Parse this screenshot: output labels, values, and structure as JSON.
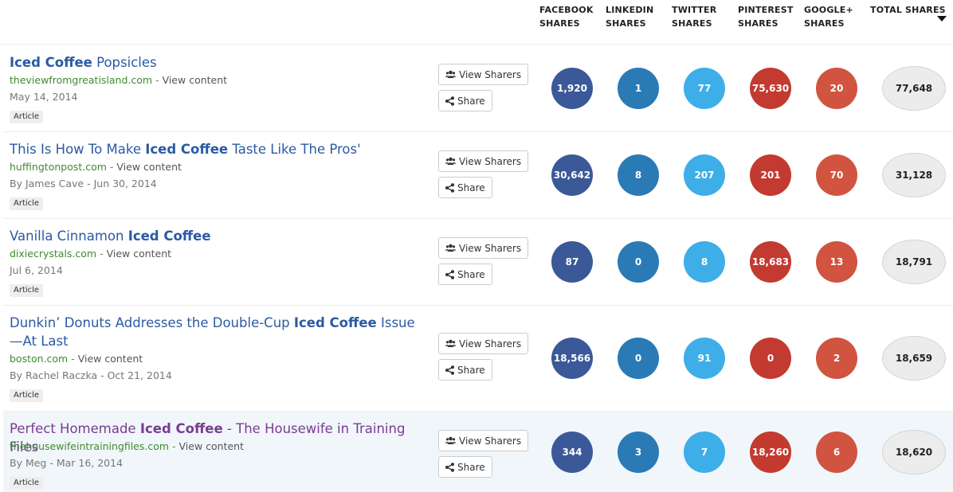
{
  "columns": {
    "facebook": [
      "FACEBOOK",
      "SHARES"
    ],
    "linkedin": [
      "LINKEDIN",
      "SHARES"
    ],
    "twitter": [
      "TWITTER",
      "SHARES"
    ],
    "pinterest": [
      "PINTEREST",
      "SHARES"
    ],
    "googleplus": [
      "GOOGLE+",
      "SHARES"
    ],
    "total": "TOTAL SHARES"
  },
  "buttons": {
    "view_sharers": "View Sharers",
    "share": "Share"
  },
  "view_content": "View content",
  "separator": " - ",
  "articles": [
    {
      "title_parts": [
        {
          "text": "Iced Coffee",
          "bold": true
        },
        {
          "text": " Popsicles",
          "bold": false
        }
      ],
      "domain": "theviewfromgreatisland.com",
      "byline": "May 14, 2014",
      "type": "Article",
      "shares": {
        "facebook": "1,920",
        "linkedin": "1",
        "twitter": "77",
        "pinterest": "75,630",
        "googleplus": "20",
        "total": "77,648"
      }
    },
    {
      "title_parts": [
        {
          "text": "This Is How To Make ",
          "bold": false
        },
        {
          "text": "Iced Coffee",
          "bold": true
        },
        {
          "text": " Taste Like The Pros'",
          "bold": false
        }
      ],
      "domain": "huffingtonpost.com",
      "byline": "By James Cave - Jun 30, 2014",
      "type": "Article",
      "shares": {
        "facebook": "30,642",
        "linkedin": "8",
        "twitter": "207",
        "pinterest": "201",
        "googleplus": "70",
        "total": "31,128"
      }
    },
    {
      "title_parts": [
        {
          "text": "Vanilla Cinnamon ",
          "bold": false
        },
        {
          "text": "Iced Coffee",
          "bold": true
        }
      ],
      "domain": "dixiecrystals.com",
      "byline": "Jul 6, 2014",
      "type": "Article",
      "shares": {
        "facebook": "87",
        "linkedin": "0",
        "twitter": "8",
        "pinterest": "18,683",
        "googleplus": "13",
        "total": "18,791"
      }
    },
    {
      "title_parts": [
        {
          "text": "Dunkin’ Donuts Addresses the Double-Cup ",
          "bold": false
        },
        {
          "text": "Iced Coffee",
          "bold": true
        },
        {
          "text": " Issue—At Last",
          "bold": false
        }
      ],
      "domain": "boston.com",
      "byline": "By Rachel Raczka - Oct 21, 2014",
      "type": "Article",
      "shares": {
        "facebook": "18,566",
        "linkedin": "0",
        "twitter": "91",
        "pinterest": "0",
        "googleplus": "2",
        "total": "18,659"
      }
    },
    {
      "title_parts": [
        {
          "text": "Perfect Homemade ",
          "bold": false
        },
        {
          "text": "Iced Coffee",
          "bold": true
        },
        {
          "text": " - The Housewife in Training Files",
          "bold": false
        }
      ],
      "domain": "thehousewifeintrainingfiles.com",
      "byline": "By Meg - Mar 16, 2014",
      "type": "Article",
      "shares": {
        "facebook": "344",
        "linkedin": "3",
        "twitter": "7",
        "pinterest": "18,260",
        "googleplus": "6",
        "total": "18,620"
      }
    }
  ]
}
